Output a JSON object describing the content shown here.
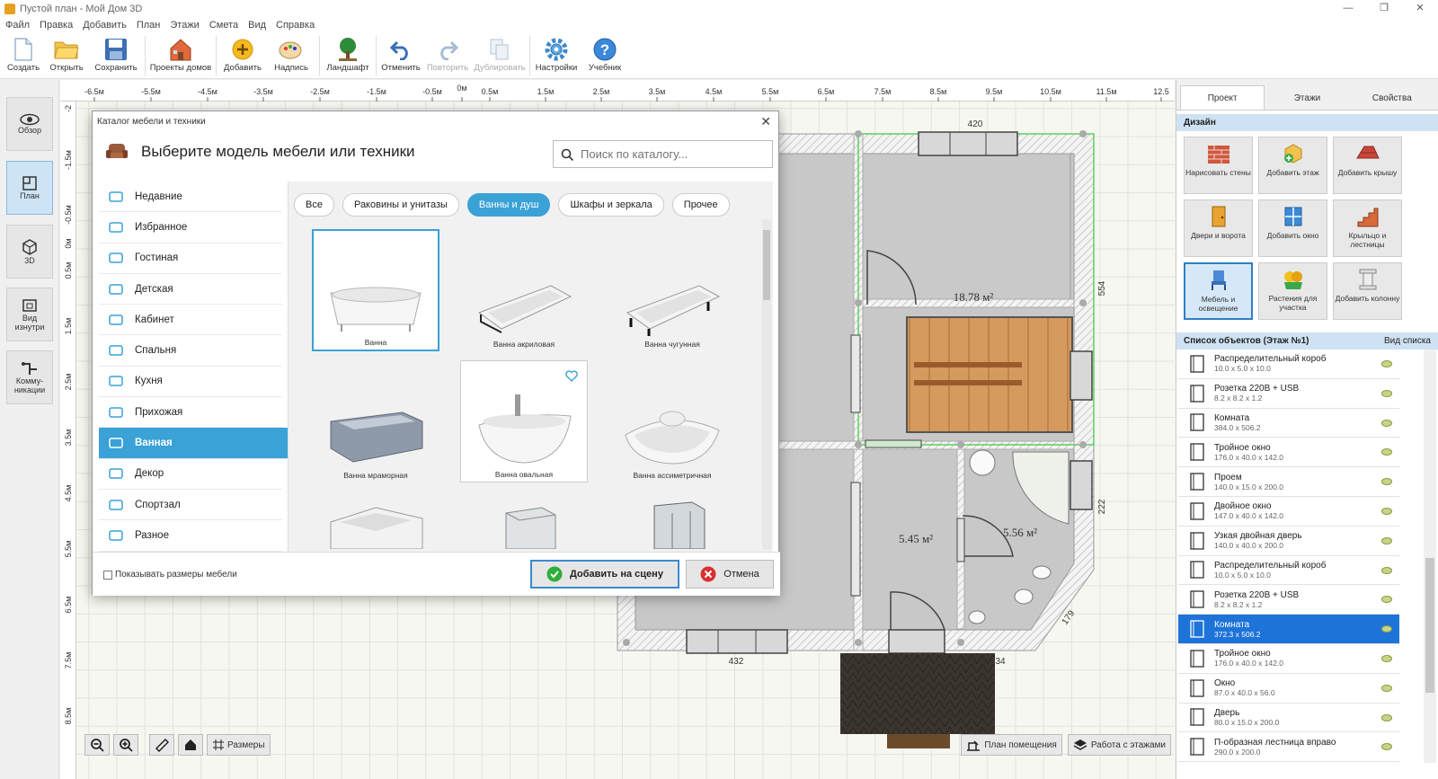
{
  "window": {
    "title": "Пустой план - Мой Дом 3D",
    "minimize": "—",
    "restore": "❐",
    "close": "✕"
  },
  "menu": [
    "Файл",
    "Правка",
    "Добавить",
    "План",
    "Этажи",
    "Смета",
    "Вид",
    "Справка"
  ],
  "toolbar": [
    "Создать",
    "Открыть",
    "Сохранить",
    "Проекты домов",
    "Добавить",
    "Надпись",
    "Ландшафт",
    "Отменить",
    "Повторить",
    "Дублировать",
    "Настройки",
    "Учебник"
  ],
  "left_panel": [
    "Обзор",
    "План",
    "3D",
    "Вид изнутри",
    "Комму- никации"
  ],
  "ruler": {
    "h": [
      "-6.5м",
      "-5.5м",
      "-4.5м",
      "-3.5м",
      "-2.5м",
      "-1.5м",
      "-0.5м",
      "0м",
      "0.5м",
      "1.5м",
      "2.5м",
      "3.5м",
      "4.5м",
      "5.5м",
      "6.5м",
      "7.5м",
      "8.5м",
      "9.5м",
      "10.5м",
      "11.5м",
      "12.5"
    ],
    "v": [
      "-2",
      "-1.5м",
      "-0.5м",
      "0м",
      "0.5м",
      "1.5м",
      "2.5м",
      "3.5м",
      "4.5м",
      "5.5м",
      "6.5м",
      "7.5м",
      "8.5м"
    ]
  },
  "plan": {
    "dims": [
      "420",
      "554",
      "222",
      "179",
      "432",
      "34"
    ],
    "areas": [
      "18.78 м²",
      "5.45 м²",
      "5.56 м²"
    ]
  },
  "bottom": {
    "sizes": "Размеры",
    "room_plan": "План помещения",
    "floors_work": "Работа с этажами"
  },
  "right_panel": {
    "tabs": [
      "Проект",
      "Этажи",
      "Свойства"
    ],
    "design_label": "Дизайн",
    "design_buttons": [
      "Нарисовать стены",
      "Добавить этаж",
      "Добавить крышу",
      "Двери и ворота",
      "Добавить окно",
      "Крыльцо и лестницы",
      "Мебель и освещение",
      "Растения для участка",
      "Добавить колонну"
    ],
    "objects_label": "Список объектов (Этаж №1)",
    "list_view": "Вид списка",
    "objects": [
      {
        "name": "Распределительный короб",
        "dims": "10.0 x 5.0 x 10.0"
      },
      {
        "name": "Розетка 220В + USB",
        "dims": "8.2 x 8.2 x 1.2"
      },
      {
        "name": "Комната",
        "dims": "384.0 x 506.2"
      },
      {
        "name": "Тройное окно",
        "dims": "176.0 x 40.0 x 142.0"
      },
      {
        "name": "Проем",
        "dims": "140.0 x 15.0 x 200.0"
      },
      {
        "name": "Двойное окно",
        "dims": "147.0 x 40.0 x 142.0"
      },
      {
        "name": "Узкая двойная дверь",
        "dims": "140.0 x 40.0 x 200.0"
      },
      {
        "name": "Распределительный короб",
        "dims": "10.0 x 5.0 x 10.0"
      },
      {
        "name": "Розетка 220В + USB",
        "dims": "8.2 x 8.2 x 1.2"
      },
      {
        "name": "Комната",
        "dims": "372.3 x 506.2"
      },
      {
        "name": "Тройное окно",
        "dims": "176.0 x 40.0 x 142.0"
      },
      {
        "name": "Окно",
        "dims": "87.0 x 40.0 x 56.0"
      },
      {
        "name": "Дверь",
        "dims": "80.0 x 15.0 x 200.0"
      },
      {
        "name": "П-образная лестница вправо",
        "dims": "290.0 x 200.0"
      }
    ]
  },
  "dialog": {
    "title": "Каталог мебели и техники",
    "heading": "Выберите модель мебели или техники",
    "search_placeholder": "Поиск по каталогу...",
    "categories": [
      "Недавние",
      "Избранное",
      "Гостиная",
      "Детская",
      "Кабинет",
      "Спальня",
      "Кухня",
      "Прихожая",
      "Ванная",
      "Декор",
      "Спортзал",
      "Разное"
    ],
    "filters": [
      "Все",
      "Раковины и унитазы",
      "Ванны и душ",
      "Шкафы и зеркала",
      "Прочее"
    ],
    "items": [
      "Ванна",
      "Ванна акриловая",
      "Ванна чугунная",
      "Ванна мраморная",
      "Ванна овальная",
      "Ванна ассиметричная"
    ],
    "show_sizes": "Показывать размеры мебели",
    "add_button": "Добавить на сцену",
    "cancel_button": "Отмена"
  },
  "colors": {
    "accent": "#3aa2d6",
    "selection": "#1e73d8",
    "section": "#cfe2f3"
  }
}
